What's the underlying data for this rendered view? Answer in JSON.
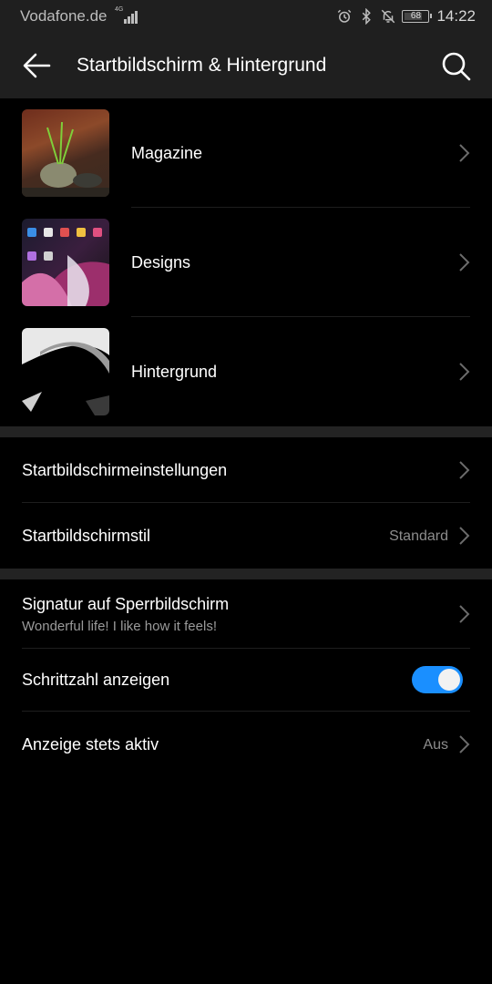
{
  "status_bar": {
    "carrier": "Vodafone.de",
    "network_type": "4G",
    "battery": "68",
    "time": "14:22",
    "icons": [
      "alarm-icon",
      "bluetooth-icon",
      "notifications-off-icon"
    ]
  },
  "app_bar": {
    "title": "Startbildschirm & Hintergrund"
  },
  "theme_items": [
    {
      "label": "Magazine",
      "icon": "magazine-thumbnail"
    },
    {
      "label": "Designs",
      "icon": "designs-thumbnail"
    },
    {
      "label": "Hintergrund",
      "icon": "wallpaper-thumbnail"
    }
  ],
  "settings": {
    "home_settings": {
      "label": "Startbildschirmeinstellungen"
    },
    "home_style": {
      "label": "Startbildschirmstil",
      "value": "Standard"
    },
    "lock_signature": {
      "label": "Signatur auf Sperrbildschirm",
      "subtitle": "Wonderful life! I like how it feels!"
    },
    "step_count": {
      "label": "Schrittzahl anzeigen",
      "enabled": true
    },
    "always_on": {
      "label": "Anzeige stets aktiv",
      "value": "Aus"
    }
  },
  "colors": {
    "toggle_on": "#1a8fff",
    "header_bg": "#1f1f1f",
    "background": "#000000"
  }
}
